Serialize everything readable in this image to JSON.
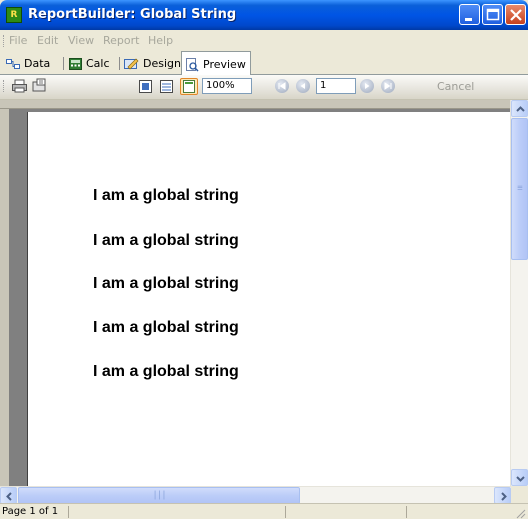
{
  "window": {
    "title": "ReportBuilder: Global String",
    "app_icon_letter": "R"
  },
  "menu": {
    "items": [
      "File",
      "Edit",
      "View",
      "Report",
      "Help"
    ]
  },
  "tabs": [
    {
      "label": "Data",
      "icon": "data-icon"
    },
    {
      "label": "Calc",
      "icon": "calc-icon"
    },
    {
      "label": "Design",
      "icon": "design-icon"
    },
    {
      "label": "Preview",
      "icon": "preview-icon",
      "active": true
    }
  ],
  "toolbar": {
    "zoom": "100%",
    "page_number": "1",
    "cancel_label": "Cancel"
  },
  "report": {
    "lines": [
      "I am a global string",
      "I am a global string",
      "I am a global string",
      "I am a global string",
      "I am a global string"
    ]
  },
  "status": {
    "page_text": "Page 1 of 1"
  },
  "colors": {
    "titlebar": "#0055e5",
    "window_bg": "#ece9d8",
    "preview_bg": "#808080",
    "scroll_thumb": "#bccdf8"
  }
}
